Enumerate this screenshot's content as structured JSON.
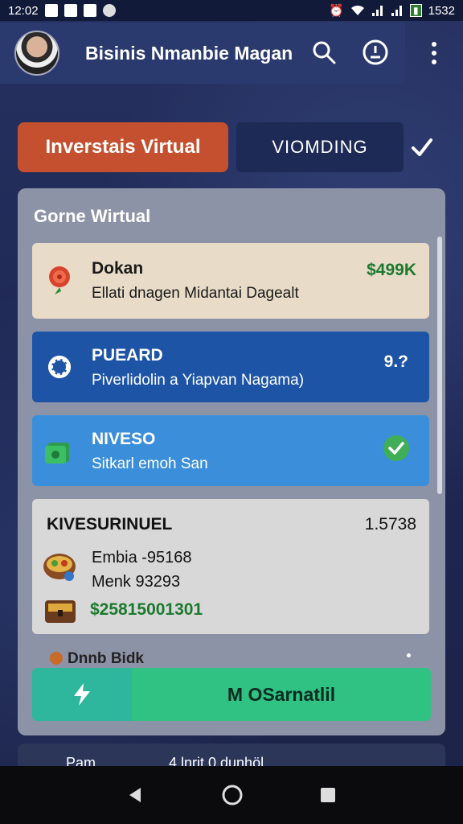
{
  "status_bar": {
    "time": "12:02",
    "battery": "1532"
  },
  "app_bar": {
    "title": "Bisinis Nmanbie Magan"
  },
  "tabs": {
    "primary_label": "Inverstais Virtual",
    "secondary_label": "VIOMDING"
  },
  "panel": {
    "title": "Gorne Wirtual",
    "cards": [
      {
        "title": "Dokan",
        "subtitle": "Ellati dnagen Midantai Dagealt",
        "value": "$499K",
        "icon": "rose-icon"
      },
      {
        "title": "PUEARD",
        "subtitle": "Piverlidolin a Yiapvan Nagama)",
        "value": "9.?",
        "icon": "gear-icon"
      },
      {
        "title": "NIVESO",
        "subtitle": "Sitkarl emoh San",
        "value": "",
        "icon": "money-icon"
      }
    ],
    "summary_card": {
      "title": "KIVESURINUEL",
      "value": "1.5738",
      "line1": "Embia -95168",
      "line2": "Menk 93293",
      "amount": "$25815001301"
    },
    "peek_item": "Dnnb Bidk",
    "cta_label": "M OSarnatlil"
  },
  "peek_row": {
    "label": "Pam",
    "value": "4 lnrit 0 dunhöl"
  },
  "colors": {
    "accent_orange": "#c5502f",
    "card_blue": "#1d54a6",
    "card_light_blue": "#3b8fda",
    "cta_green": "#2fc282",
    "value_green": "#1b7a2e"
  }
}
